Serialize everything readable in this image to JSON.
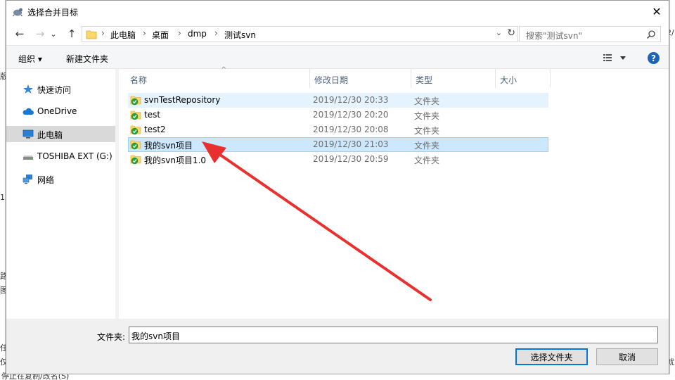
{
  "window": {
    "title": "选择合并目标",
    "close_glyph": "✕"
  },
  "background_fragments": {
    "left_top": "版",
    "left_mid": "1",
    "left_low": "路",
    "left_low2": "图",
    "left_bottom1": "任",
    "left_bottom2": "仅",
    "right_top": "2/",
    "right_bottom": "就",
    "bottom_text": "停止在复制/改名(S)"
  },
  "address": {
    "breadcrumbs": [
      "此电脑",
      "桌面",
      "dmp",
      "测试svn"
    ],
    "separator": "›",
    "dropdown_glyph": "⌄",
    "refresh_glyph": "↻"
  },
  "nav_buttons": {
    "back": "←",
    "forward": "→",
    "history": "⌄",
    "up": "↑"
  },
  "search": {
    "placeholder": "搜索\"测试svn\""
  },
  "toolbar": {
    "organize_label": "组织 ▾",
    "new_folder_label": "新建文件夹",
    "help_label": "?"
  },
  "nav_pane": {
    "items": [
      {
        "label": "快速访问",
        "icon": "star-icon"
      },
      {
        "label": "OneDrive",
        "icon": "cloud-icon"
      },
      {
        "label": "此电脑",
        "icon": "computer-icon",
        "selected": true
      },
      {
        "label": "TOSHIBA EXT (G:)",
        "icon": "drive-icon"
      },
      {
        "label": "网络",
        "icon": "network-icon"
      }
    ]
  },
  "columns": {
    "name": "名称",
    "modified": "修改日期",
    "type": "类型",
    "size": "大小",
    "sort_glyph": "^"
  },
  "files": [
    {
      "name": "svnTestRepository",
      "modified": "2019/12/30 20:33",
      "type": "文件夹",
      "state": "hover"
    },
    {
      "name": "test",
      "modified": "2019/12/30 20:20",
      "type": "文件夹",
      "state": ""
    },
    {
      "name": "test2",
      "modified": "2019/12/30 20:08",
      "type": "文件夹",
      "state": ""
    },
    {
      "name": "我的svn项目",
      "modified": "2019/12/30 21:03",
      "type": "文件夹",
      "state": "selected"
    },
    {
      "name": "我的svn项目1.0",
      "modified": "2019/12/30 20:59",
      "type": "文件夹",
      "state": ""
    }
  ],
  "bottom": {
    "folder_label": "文件夹:",
    "folder_value": "我的svn项目",
    "select_button": "选择文件夹",
    "cancel_button": "取消"
  },
  "colors": {
    "accent": "#0078d7",
    "selected_row": "#cce8ff",
    "hover_row": "#e5f3ff",
    "annotation_arrow": "#e8302f"
  }
}
